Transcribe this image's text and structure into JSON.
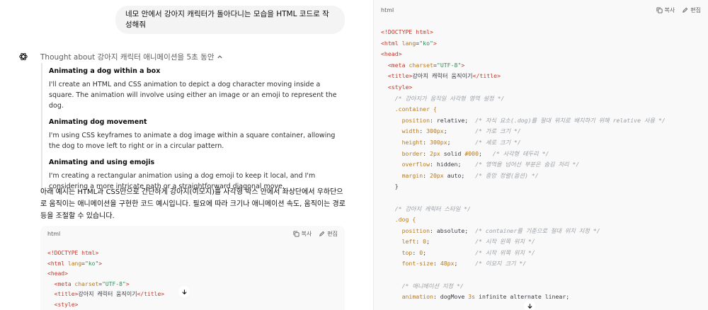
{
  "user_message": "네모 안에서 강아지 캐릭터가 돌아다니는 모습을 HTML 코드로 작성해줘",
  "thought_header": "Thought about 강아지 캐릭터 애니메이션을 5초 동안",
  "thought_sections": [
    {
      "title": "Animating a dog within a box",
      "body": "I'll create an HTML and CSS animation to depict a dog character moving inside a square. The animation will involve using either an image or an emoji to represent the dog."
    },
    {
      "title": "Animating dog movement",
      "body": "I'm using CSS keyframes to animate a dog image within a square container, allowing the dog to move left to right or in a circular pattern."
    },
    {
      "title": "Animating and using emojis",
      "body": "I'm creating a rectangular animation using a dog emoji to keep it local, and I'm considering a more intricate path or a straightforward diagonal move."
    }
  ],
  "answer_text": "아래 예시는 HTML과 CSS만으로 간단하게 강아지(이모지)를 사각형 박스 안에서 좌상단에서 우하단으로 움직이는 애니메이션을 구현한 코드 예시입니다. 필요에 따라 크기나 애니메이션 속도, 움직이는 경로 등을 조절할 수 있습니다.",
  "code_block": {
    "lang": "html",
    "copy_label": "복사",
    "edit_label": "편집"
  },
  "left_code": {
    "l1a": "<!DOCTYPE ",
    "l1b": "html",
    "l1c": ">",
    "l2a": "<html ",
    "l2b": "lang",
    "l2c": "=",
    "l2d": "\"ko\"",
    "l2e": ">",
    "l3": "<head>",
    "l4a": "<meta ",
    "l4b": "charset",
    "l4c": "=",
    "l4d": "\"UTF-8\"",
    "l4e": ">",
    "l5a": "<title>",
    "l5b": "강아지 캐릭터 움직이기",
    "l5c": "</title>",
    "l6": "<style>"
  },
  "right_code": {
    "l1a": "<!DOCTYPE ",
    "l1b": "html",
    "l1c": ">",
    "l2a": "<html ",
    "l2b": "lang",
    "l2c": "=",
    "l2d": "\"ko\"",
    "l2e": ">",
    "l3": "<head>",
    "l4a": "<meta ",
    "l4b": "charset",
    "l4c": "=",
    "l4d": "\"UTF-8\"",
    "l4e": ">",
    "l5a": "<title>",
    "l5b": "강아지 캐릭터 움직이기",
    "l5c": "</title>",
    "l6": "<style>",
    "c1": "/* 강아지가 움직일 사각형 영역 설정 */",
    "s1": ".container {",
    "p1": "position",
    "v1": ": relative;",
    "c2": "/* 자식 요소(.dog)를 절대 위치로 배치하기 위해 relative 사용 */",
    "p2": "width",
    "v2a": ": ",
    "v2b": "300px",
    "v2c": ";",
    "c3": "/* 가로 크기 */",
    "p3": "height",
    "v3a": ": ",
    "v3b": "300px",
    "v3c": ";",
    "c4": "/* 세로 크기 */",
    "p4": "border",
    "v4a": ": ",
    "v4b": "2px",
    "v4c": " solid ",
    "v4d": "#000",
    "v4e": ";",
    "c5": "/* 사각형 테두리 */",
    "p5": "overflow",
    "v5": ": hidden;",
    "c6": "/* 영역을 넘어선 부분은 숨김 처리 */",
    "p6": "margin",
    "v6a": ": ",
    "v6b": "20px",
    "v6c": " auto;",
    "c7": "/* 중앙 정렬(옵션) */",
    "e1": "}",
    "c8": "/* 강아지 캐릭터 스타일 */",
    "s2": ".dog {",
    "p7": "position",
    "v7": ": absolute;",
    "c9": "/* container를 기준으로 절대 위치 지정 */",
    "p8": "left",
    "v8a": ": ",
    "v8b": "0",
    "v8c": ";",
    "c10": "/* 시작 왼쪽 위치 */",
    "p9": "top",
    "v9a": ": ",
    "v9b": "0",
    "v9c": ";",
    "c11": "/* 시작 위쪽 위치 */",
    "p10": "font-size",
    "v10a": ": ",
    "v10b": "48px",
    "v10c": ";",
    "c12": "/* 이모지 크기 */",
    "c13": "/* 애니메이션 지정 */",
    "p11": "animation",
    "v11a": ": dogMove ",
    "v11b": "3s",
    "v11c": " infinite alternate linear;"
  },
  "colors": {
    "bubble_bg": "#f4f4f4",
    "code_bg": "#f9f9f9",
    "tag": "#c0392b",
    "string": "#2e8b57",
    "property": "#b7791f",
    "comment": "#9aa0a6"
  },
  "icons": [
    "openai-logo-icon",
    "chevron-up-icon",
    "copy-icon",
    "edit-icon",
    "arrow-down-icon"
  ]
}
